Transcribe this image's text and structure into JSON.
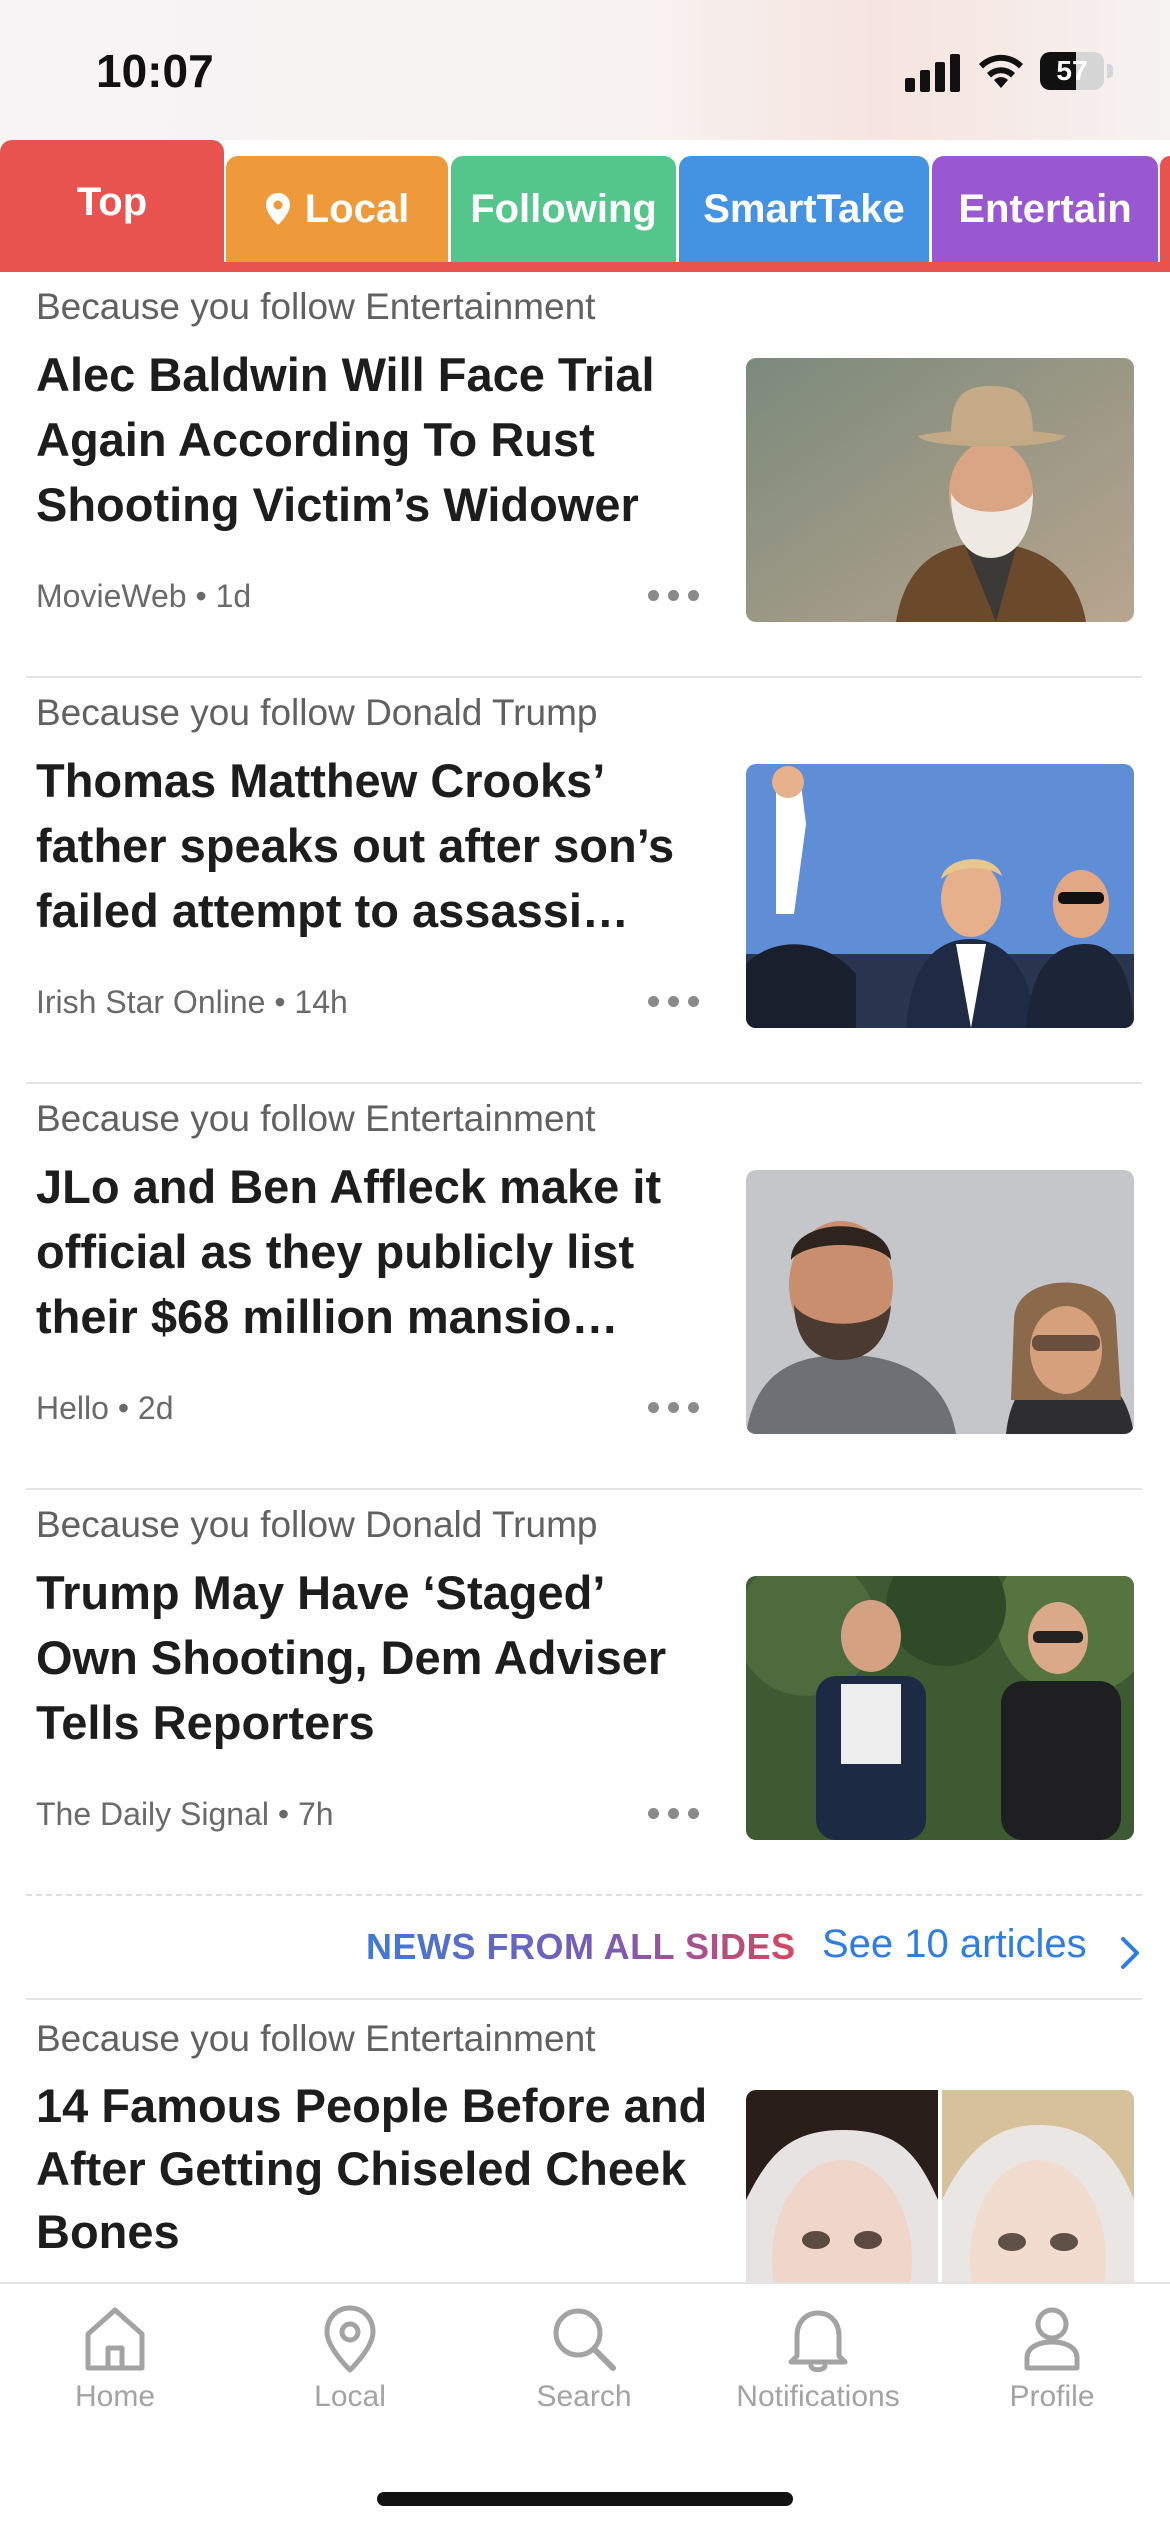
{
  "status_bar": {
    "time": "10:07",
    "battery": "57",
    "battery_level": 0.57
  },
  "tabs": [
    {
      "label": "Top",
      "color": "#e8534f",
      "active": true
    },
    {
      "label": "Local",
      "color": "#ef9a3a",
      "icon": "location-pin-icon"
    },
    {
      "label": "Following",
      "color": "#55c68b"
    },
    {
      "label": "SmartTake",
      "color": "#4393e2"
    },
    {
      "label": "Entertain",
      "color": "#9a57d2"
    }
  ],
  "articles": [
    {
      "because": "Because you follow Entertainment",
      "headline": "Alec Baldwin Will Face Trial Again According To Rust Shooting Victim’s Widower",
      "source": "MovieWeb",
      "age": "1d",
      "image": "Man with white beard in cowboy hat"
    },
    {
      "because": "Because you follow Donald Trump",
      "headline": "Thomas Matthew Crooks’ father speaks out after son’s failed attempt to assassi…",
      "source": "Irish Star Online",
      "age": "14h",
      "image": "Raised fist with security agents"
    },
    {
      "because": "Because you follow Entertainment",
      "headline": "JLo and Ben Affleck make it official as they publicly list their $68 million mansio…",
      "source": "Hello",
      "age": "2d",
      "image": "Man and woman in sunglasses outdoors"
    },
    {
      "because": "Because you follow Donald Trump",
      "headline": "Trump May Have ‘Staged’ Own Shooting, Dem Adviser Tells Reporters",
      "source": "The Daily Signal",
      "age": "7h",
      "image": "Two men walking among trees"
    },
    {
      "because": "Because you follow Entertainment",
      "headline": "14 Famous People Before and After Getting Chiseled Cheek Bones",
      "source": "",
      "age": "",
      "image": "Before and after face comparison"
    }
  ],
  "news_from_all_sides": {
    "label": "NEWS FROM ALL SIDES",
    "link": "See 10 articles"
  },
  "bottom_nav": [
    {
      "label": "Home",
      "icon": "home-icon"
    },
    {
      "label": "Local",
      "icon": "location-pin-icon"
    },
    {
      "label": "Search",
      "icon": "search-icon"
    },
    {
      "label": "Notifications",
      "icon": "bell-icon"
    },
    {
      "label": "Profile",
      "icon": "person-icon"
    }
  ]
}
